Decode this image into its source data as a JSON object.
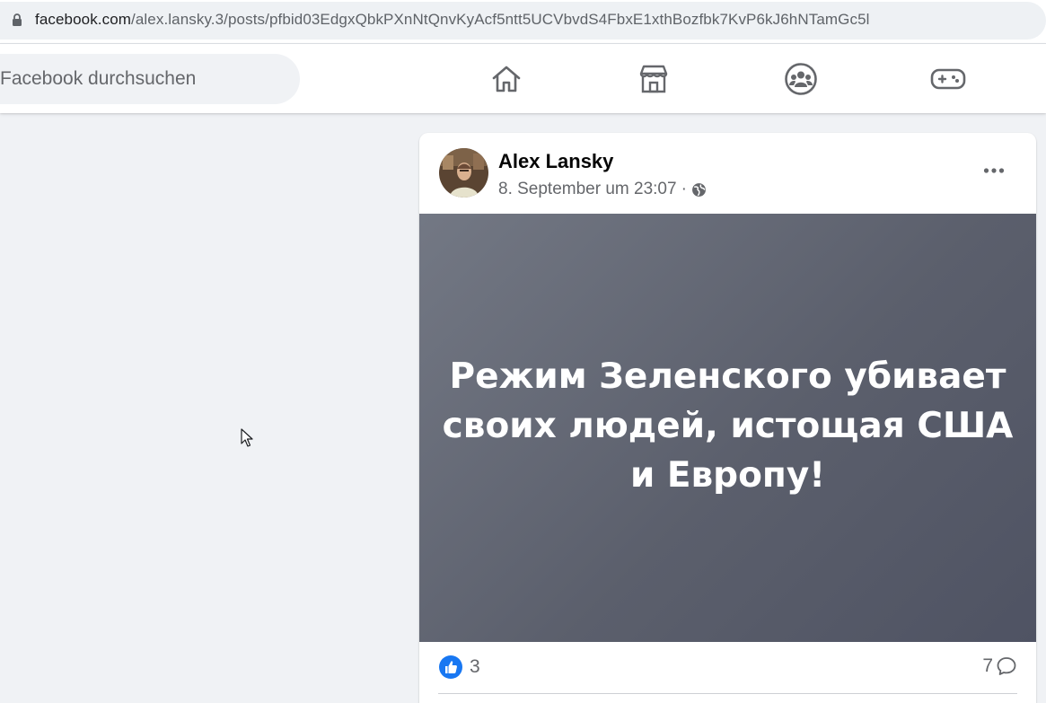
{
  "browser": {
    "url_domain": "facebook.com",
    "url_path": "/alex.lansky.3/posts/pfbid03EdgxQbkPXnNtQnvKyAcf5ntt5UCVbvdS4FbxE1xthBozfbk7KvP6kJ6hNTamGc5l",
    "lock_icon": "lock-icon"
  },
  "header": {
    "search_placeholder": "Facebook durchsuchen",
    "nav_icons": [
      "home-icon",
      "marketplace-icon",
      "groups-icon",
      "gaming-icon"
    ]
  },
  "post": {
    "author": "Alex Lansky",
    "timestamp": "8. September um 23:07",
    "separator": "·",
    "audience_icon": "globe-icon",
    "image_text": "Режим Зеленского убивает своих людей, истощая США и Европу!",
    "reaction_count": "3",
    "comment_count": "7"
  },
  "colors": {
    "page_bg": "#f0f2f5",
    "like_blue": "#1877f2",
    "secondary_text": "#65676b"
  }
}
